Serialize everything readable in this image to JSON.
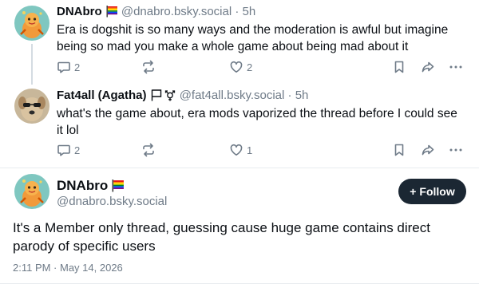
{
  "posts": [
    {
      "name": "DNAbro",
      "handle": "@dnabro.bsky.social",
      "time": "5h",
      "text": "Era is dogshit is so many ways and the moderation is awful but imagine being so mad you make a whole game about being mad about it",
      "replies": "2",
      "likes": "2"
    },
    {
      "name": "Fat4all (Agatha)",
      "handle": "@fat4all.bsky.social",
      "time": "5h",
      "text": "what's the game about, era mods vaporized the thread before I could see it lol",
      "replies": "2",
      "likes": "1"
    }
  ],
  "focused": {
    "name": "DNAbro",
    "handle": "@dnabro.bsky.social",
    "follow_label": "Follow",
    "text": "It's a Member only thread, guessing cause huge game contains direct parody of specific users",
    "timestamp": "2:11 PM · May 14, 2026"
  },
  "separator": "·",
  "colors": {
    "text": "#0b0f14",
    "muted": "#6f7b88",
    "follow_bg": "#1b2733",
    "line": "#d4dbe2"
  },
  "icons": [
    "reply-icon",
    "repost-icon",
    "like-icon",
    "bookmark-icon",
    "share-icon",
    "more-icon",
    "rainbow-flag-icon",
    "flag-outline-icon",
    "gender-symbol-icon",
    "plus-icon"
  ]
}
